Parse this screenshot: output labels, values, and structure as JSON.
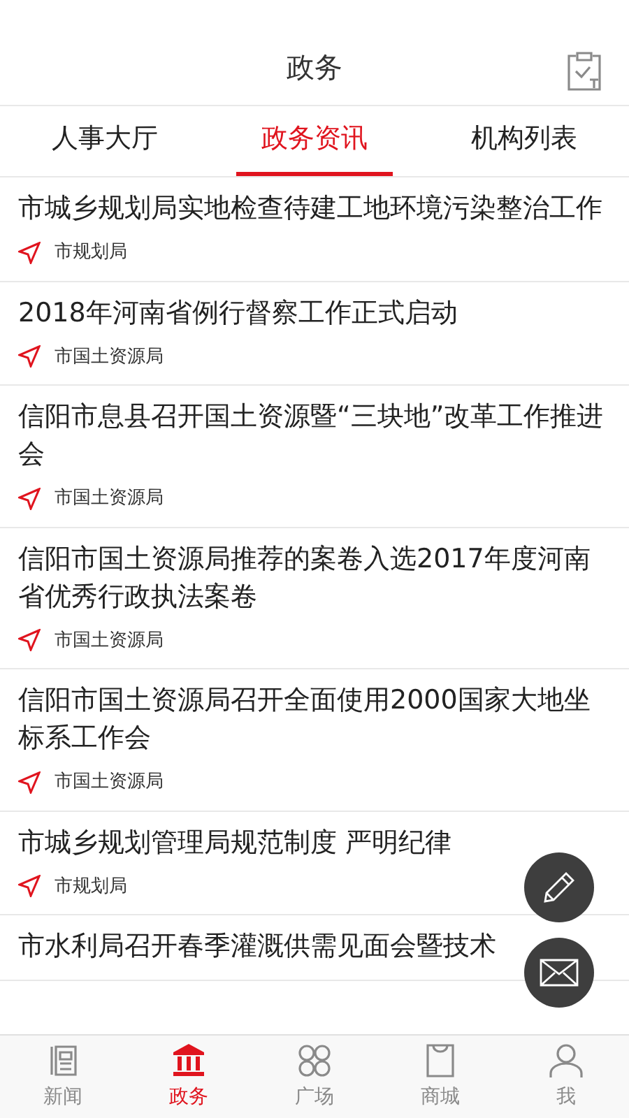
{
  "header": {
    "title": "政务"
  },
  "tabs": [
    {
      "label": "人事大厅",
      "selected": false
    },
    {
      "label": "政务资讯",
      "selected": true
    },
    {
      "label": "机构列表",
      "selected": false
    }
  ],
  "articles": [
    {
      "title": "市城乡规划局实地检查待建工地环境污染整治工作",
      "source": "市规划局"
    },
    {
      "title": "2018年河南省例行督察工作正式启动",
      "source": "市国土资源局"
    },
    {
      "title": "信阳市息县召开国土资源暨“三块地”改革工作推进会",
      "source": "市国土资源局"
    },
    {
      "title": "信阳市国土资源局推荐的案卷入选2017年度河南省优秀行政执法案卷",
      "source": "市国土资源局"
    },
    {
      "title": "信阳市国土资源局召开全面使用2000国家大地坐标系工作会",
      "source": "市国土资源局"
    },
    {
      "title": "市城乡规划管理局规范制度 严明纪律",
      "source": "市规划局"
    },
    {
      "title": "市水利局召开春季灌溉供需见面会暨技术"
    }
  ],
  "bottom_nav": [
    {
      "label": "新闻",
      "selected": false,
      "kind": "news"
    },
    {
      "label": "政务",
      "selected": true,
      "kind": "gov"
    },
    {
      "label": "广场",
      "selected": false,
      "kind": "square"
    },
    {
      "label": "商城",
      "selected": false,
      "kind": "shop"
    },
    {
      "label": "我",
      "selected": false,
      "kind": "me"
    }
  ]
}
